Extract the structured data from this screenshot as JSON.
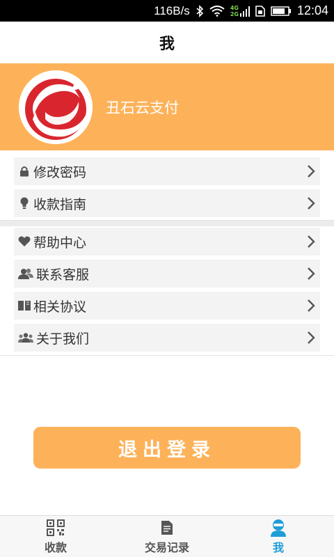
{
  "status_bar": {
    "net_speed": "116B/s",
    "net_4g": "4G",
    "net_2g": "2G",
    "time": "12:04"
  },
  "header": {
    "title": "我"
  },
  "profile": {
    "name": "丑石云支付"
  },
  "menu_group1": [
    {
      "label": "修改密码",
      "icon": "lock-icon"
    },
    {
      "label": "收款指南",
      "icon": "bulb-icon"
    }
  ],
  "menu_group2": [
    {
      "label": "帮助中心",
      "icon": "heart-icon"
    },
    {
      "label": "联系客服",
      "icon": "contacts-icon"
    },
    {
      "label": "相关协议",
      "icon": "book-icon"
    },
    {
      "label": "关于我们",
      "icon": "group-icon"
    }
  ],
  "logout_label": "退出登录",
  "tabs": [
    {
      "label": "收款",
      "icon": "qrcode-icon",
      "active": false
    },
    {
      "label": "交易记录",
      "icon": "document-icon",
      "active": false
    },
    {
      "label": "我",
      "icon": "user-icon",
      "active": true
    }
  ],
  "colors": {
    "accent": "#fdb25a",
    "active_tab": "#1d9ed8"
  }
}
